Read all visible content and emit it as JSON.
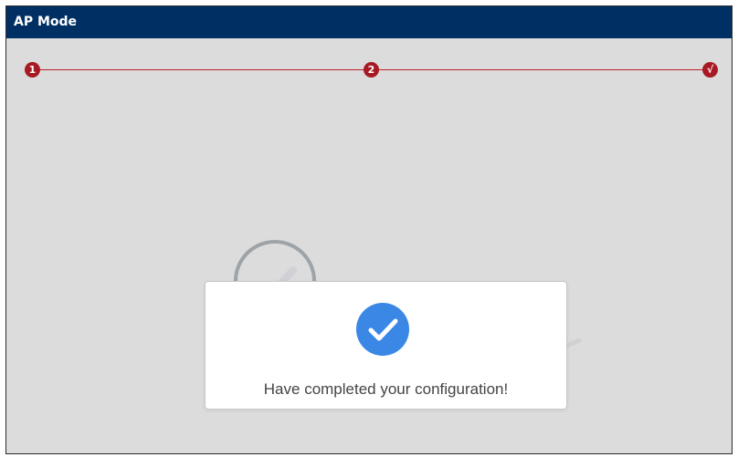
{
  "window": {
    "title": "AP Mode"
  },
  "steps": [
    {
      "label": "1"
    },
    {
      "label": "2"
    },
    {
      "label": "√"
    }
  ],
  "dialog": {
    "message": "Have completed your configuration!"
  },
  "icons": {
    "success": "check-circle-icon",
    "background_success": "check-circle-icon-faded"
  },
  "colors": {
    "titlebar": "#003063",
    "step": "#a71a23",
    "step_line": "#b9202b",
    "success": "#3a87e6",
    "background": "#dcdcdc"
  }
}
